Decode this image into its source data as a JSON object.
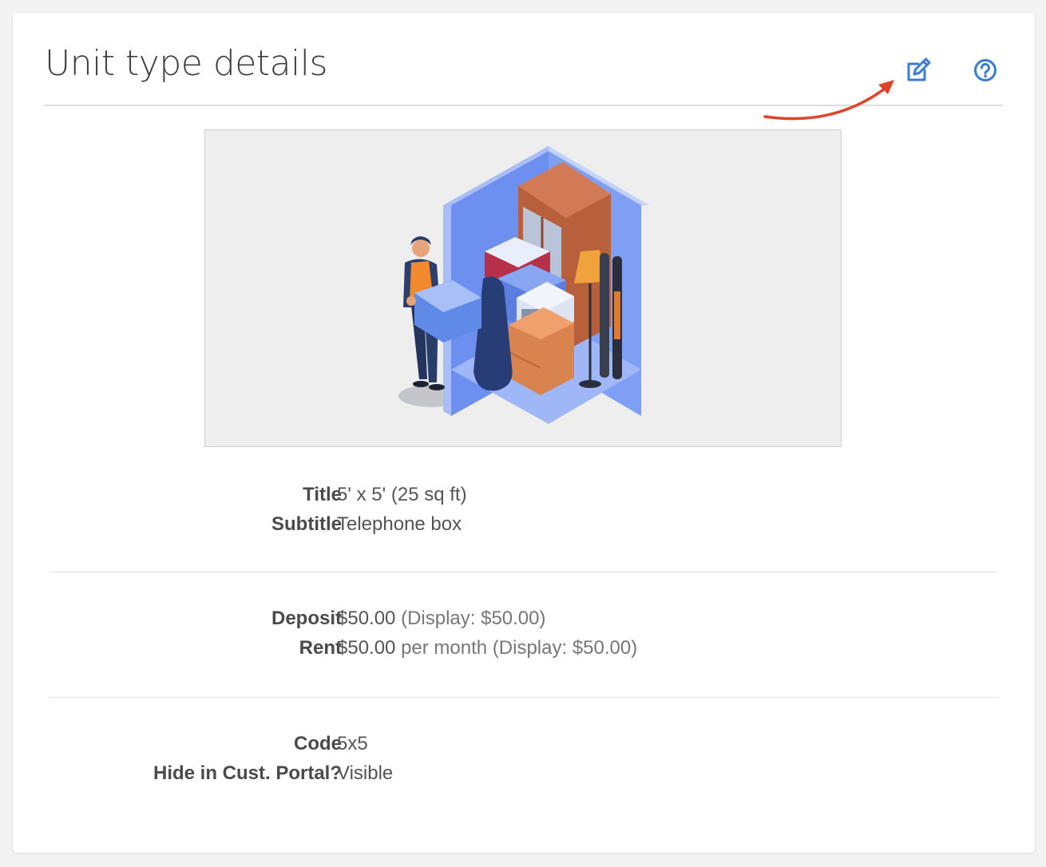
{
  "header": {
    "title": "Unit type details",
    "edit_icon": "edit-icon",
    "help_icon": "help-circle-icon"
  },
  "image": {
    "description_icon": "storage-unit-illustration"
  },
  "details": {
    "group1": [
      {
        "label": "Title",
        "value": "5' x 5' (25 sq ft)"
      },
      {
        "label": "Subtitle",
        "value": "Telephone box"
      }
    ],
    "group2": {
      "deposit": {
        "label": "Deposit",
        "amount": "$50.00",
        "extra": "(Display: $50.00)"
      },
      "rent": {
        "label": "Rent",
        "amount": "$50.00",
        "extra": "per month (Display: $50.00)"
      }
    },
    "group3": [
      {
        "label": "Code",
        "value": "5x5"
      },
      {
        "label": "Hide in Cust. Portal?",
        "value": "Visible"
      }
    ]
  },
  "colors": {
    "accent": "#3a7bd5",
    "annotation": "#e0432b",
    "label": "#4a4a4a",
    "value": "#555555"
  }
}
